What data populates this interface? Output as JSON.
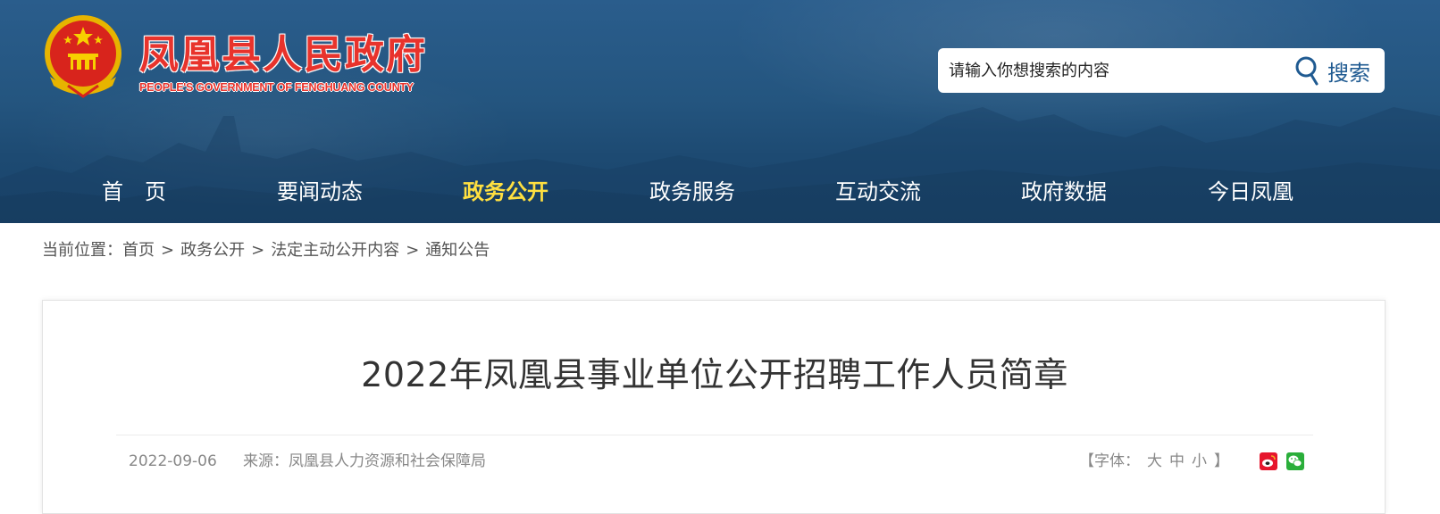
{
  "header": {
    "site_title": "凤凰县人民政府",
    "site_subtitle": "PEOPLE'S GOVERNMENT OF FENGHUANG COUNTY",
    "emblem_icon": "national-emblem-icon",
    "search": {
      "placeholder": "请输入你想搜索的内容",
      "button_label": "搜索",
      "icon": "search-icon"
    }
  },
  "nav": {
    "items": [
      {
        "label": "首　页"
      },
      {
        "label": "要闻动态"
      },
      {
        "label": "政务公开",
        "active": true
      },
      {
        "label": "政务服务"
      },
      {
        "label": "互动交流"
      },
      {
        "label": "政府数据"
      },
      {
        "label": "今日凤凰"
      }
    ]
  },
  "breadcrumb": {
    "prefix": "当前位置：",
    "items": [
      "首页",
      "政务公开",
      "法定主动公开内容",
      "通知公告"
    ],
    "separator": ">"
  },
  "article": {
    "title": "2022年凤凰县事业单位公开招聘工作人员简章",
    "date": "2022-09-06",
    "source": "来源：凤凰县人力资源和社会保障局",
    "font_control": {
      "open": "【字体：",
      "large": "大",
      "medium": "中",
      "small": "小",
      "close": "】"
    },
    "share_icons": [
      "weibo-icon",
      "wechat-icon"
    ]
  },
  "colors": {
    "header_bg": "#24557f",
    "title_red": "#e8332c",
    "nav_active": "#ffe040",
    "search_blue": "#1f5a91"
  }
}
